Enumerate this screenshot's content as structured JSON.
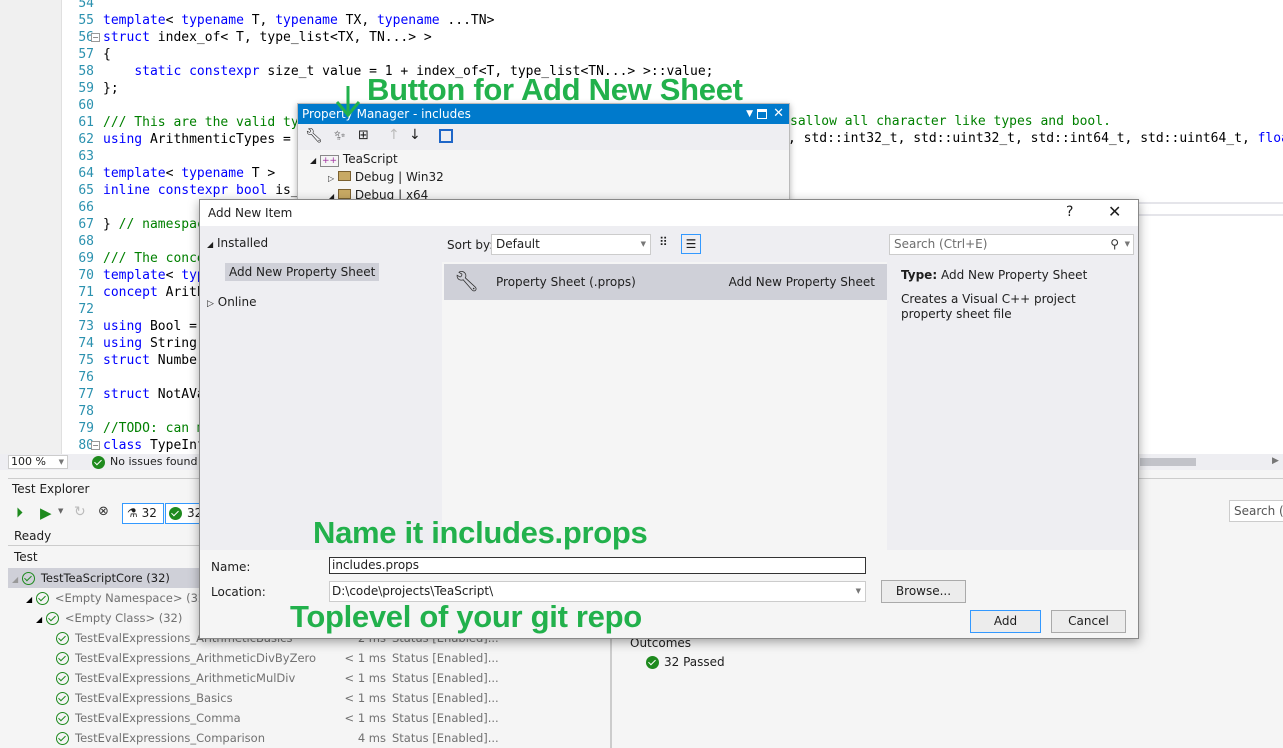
{
  "editor": {
    "lines": [
      {
        "n": "54",
        "html": []
      },
      {
        "n": "55",
        "html": [
          [
            "kw",
            "template"
          ],
          [
            "",
            "< "
          ],
          [
            "kw",
            "typename"
          ],
          [
            "",
            " T, "
          ],
          [
            "kw",
            "typename"
          ],
          [
            "",
            " TX, "
          ],
          [
            "kw",
            "typename"
          ],
          [
            "",
            " ...TN>"
          ]
        ]
      },
      {
        "n": "56",
        "html": [
          [
            "kw",
            "struct"
          ],
          [
            "",
            " index_of< T, type_list<TX, TN...> >"
          ]
        ],
        "fold": true
      },
      {
        "n": "57",
        "html": [
          [
            "",
            "{"
          ]
        ]
      },
      {
        "n": "58",
        "html": [
          [
            "",
            "    "
          ],
          [
            "kw",
            "static constexpr"
          ],
          [
            "",
            " size_t value = 1 + index_of<T, type_list<TN...> >::value;"
          ]
        ]
      },
      {
        "n": "59",
        "html": [
          [
            "",
            "};"
          ]
        ]
      },
      {
        "n": "60",
        "html": []
      },
      {
        "n": "61",
        "html": [
          [
            "cm",
            "/// This are the valid typ"
          ]
        ]
      },
      {
        "n": "62",
        "html": [
          [
            "kw",
            "using"
          ],
          [
            "",
            " ArithmenticTypes = t"
          ]
        ]
      },
      {
        "n": "63",
        "html": []
      },
      {
        "n": "64",
        "html": [
          [
            "kw",
            "template"
          ],
          [
            "",
            "< "
          ],
          [
            "kw",
            "typename"
          ],
          [
            "",
            " T >"
          ]
        ]
      },
      {
        "n": "65",
        "html": [
          [
            "kw",
            "inline constexpr bool"
          ],
          [
            "",
            " is_a"
          ]
        ]
      },
      {
        "n": "66",
        "html": []
      },
      {
        "n": "67",
        "html": [
          [
            "",
            "} "
          ],
          [
            "cm",
            "// namespac"
          ]
        ]
      },
      {
        "n": "68",
        "html": []
      },
      {
        "n": "69",
        "html": [
          [
            "cm",
            "/// The conce"
          ]
        ]
      },
      {
        "n": "70",
        "html": [
          [
            "kw",
            "template"
          ],
          [
            "",
            "< "
          ],
          [
            "kw",
            "typ"
          ]
        ]
      },
      {
        "n": "71",
        "html": [
          [
            "kw",
            "concept"
          ],
          [
            "",
            " Arith"
          ]
        ]
      },
      {
        "n": "72",
        "html": []
      },
      {
        "n": "73",
        "html": [
          [
            "kw",
            "using"
          ],
          [
            "",
            " Bool ="
          ]
        ]
      },
      {
        "n": "74",
        "html": [
          [
            "kw",
            "using"
          ],
          [
            "",
            " String"
          ]
        ]
      },
      {
        "n": "75",
        "html": [
          [
            "kw",
            "struct"
          ],
          [
            "",
            " Number"
          ]
        ]
      },
      {
        "n": "76",
        "html": []
      },
      {
        "n": "77",
        "html": [
          [
            "kw",
            "struct"
          ],
          [
            "",
            " NotAVa"
          ]
        ]
      },
      {
        "n": "78",
        "html": []
      },
      {
        "n": "79",
        "html": [
          [
            "cm",
            "//TODO: can m"
          ]
        ]
      },
      {
        "n": "80",
        "html": [
          [
            "kw",
            "class"
          ],
          [
            "",
            " TypeInf"
          ]
        ],
        "fold": true
      }
    ],
    "line61_tail": "sallow all character like types and bool.",
    "line62_tail": ", std::int32_t, std::uint32_t, std::int64_t, std::uint64_t, ",
    "line62_kw": "float",
    "zoom": "100 %",
    "issues": "No issues found"
  },
  "property_manager": {
    "title": "Property Manager - includes",
    "project": "TeaScript",
    "configs": [
      "Debug | Win32",
      "Debug | x64"
    ]
  },
  "dialog": {
    "title": "Add New Item",
    "help": "?",
    "installed": "Installed",
    "selected_category": "Add New Property Sheet",
    "online": "Online",
    "sort_label": "Sort by:",
    "sort_value": "Default",
    "search_placeholder": "Search (Ctrl+E)",
    "item_name": "Property Sheet (.props)",
    "item_type": "Add New Property Sheet",
    "type_label": "Type:",
    "type_value": "Add New Property Sheet",
    "description": "Creates a Visual C++ project property sheet file",
    "name_label": "Name:",
    "name_value": "includes.props",
    "location_label": "Location:",
    "location_value": "D:\\code\\projects\\TeaScript\\",
    "browse": "Browse...",
    "add": "Add",
    "cancel": "Cancel"
  },
  "test_explorer": {
    "title": "Test Explorer",
    "total": "32",
    "passed": "32",
    "status": "Ready",
    "column": "Test",
    "search_placeholder": "Search (C",
    "root": "TestTeaScriptCore (32)",
    "ns": "<Empty Namespace> (32)",
    "cls": "<Empty Class> (32)",
    "tests": [
      {
        "name": "TestEvalExpressions_ArithmeticBasics",
        "time": "2 ms",
        "status": "Status [Enabled]..."
      },
      {
        "name": "TestEvalExpressions_ArithmeticDivByZero",
        "time": "< 1 ms",
        "status": "Status [Enabled]..."
      },
      {
        "name": "TestEvalExpressions_ArithmeticMulDiv",
        "time": "< 1 ms",
        "status": "Status [Enabled]..."
      },
      {
        "name": "TestEvalExpressions_Basics",
        "time": "< 1 ms",
        "status": "Status [Enabled]..."
      },
      {
        "name": "TestEvalExpressions_Comma",
        "time": "< 1 ms",
        "status": "Status [Enabled]..."
      },
      {
        "name": "TestEvalExpressions_Comparison",
        "time": "4 ms",
        "status": "Status [Enabled]..."
      }
    ],
    "outcomes": "Outcomes",
    "outcomes_passed": "32 Passed"
  },
  "annotations": {
    "button": "Button for Add New Sheet",
    "name": "Name it includes.props",
    "location": "Toplevel of your git repo"
  },
  "colors": {
    "annotation": "#22b14c",
    "accent": "#007acc",
    "pass": "#1e8a1e"
  }
}
